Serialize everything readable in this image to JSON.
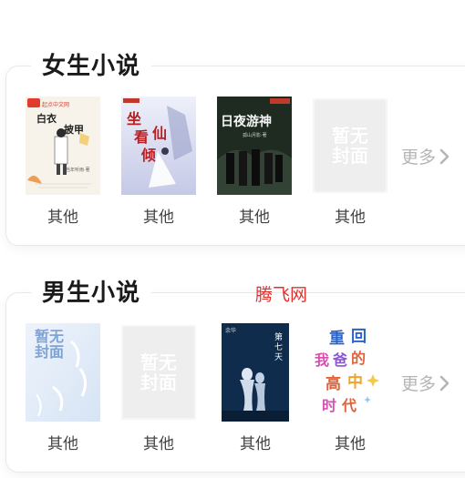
{
  "sections": [
    {
      "title": "女生小说",
      "more_label": "更多",
      "books": [
        {
          "label": "其他",
          "cover_text": "白衣 披甲"
        },
        {
          "label": "其他",
          "cover_text": "坐看仙倾"
        },
        {
          "label": "其他",
          "cover_text": "日夜游神"
        },
        {
          "label": "其他",
          "cover_text": "暂无封面"
        }
      ]
    },
    {
      "title": "男生小说",
      "more_label": "更多",
      "books": [
        {
          "label": "其他",
          "cover_text": "暂无封面"
        },
        {
          "label": "其他",
          "cover_text": "暂无封面"
        },
        {
          "label": "其他",
          "cover_text": "第七天"
        },
        {
          "label": "其他",
          "cover_text": "重回我爸的高中时代"
        }
      ]
    }
  ],
  "watermark": "腾飞网",
  "colors": {
    "accent_red": "#e0302e",
    "more_gray": "#b5b5b5",
    "placeholder_gray": "#eeeeee"
  }
}
